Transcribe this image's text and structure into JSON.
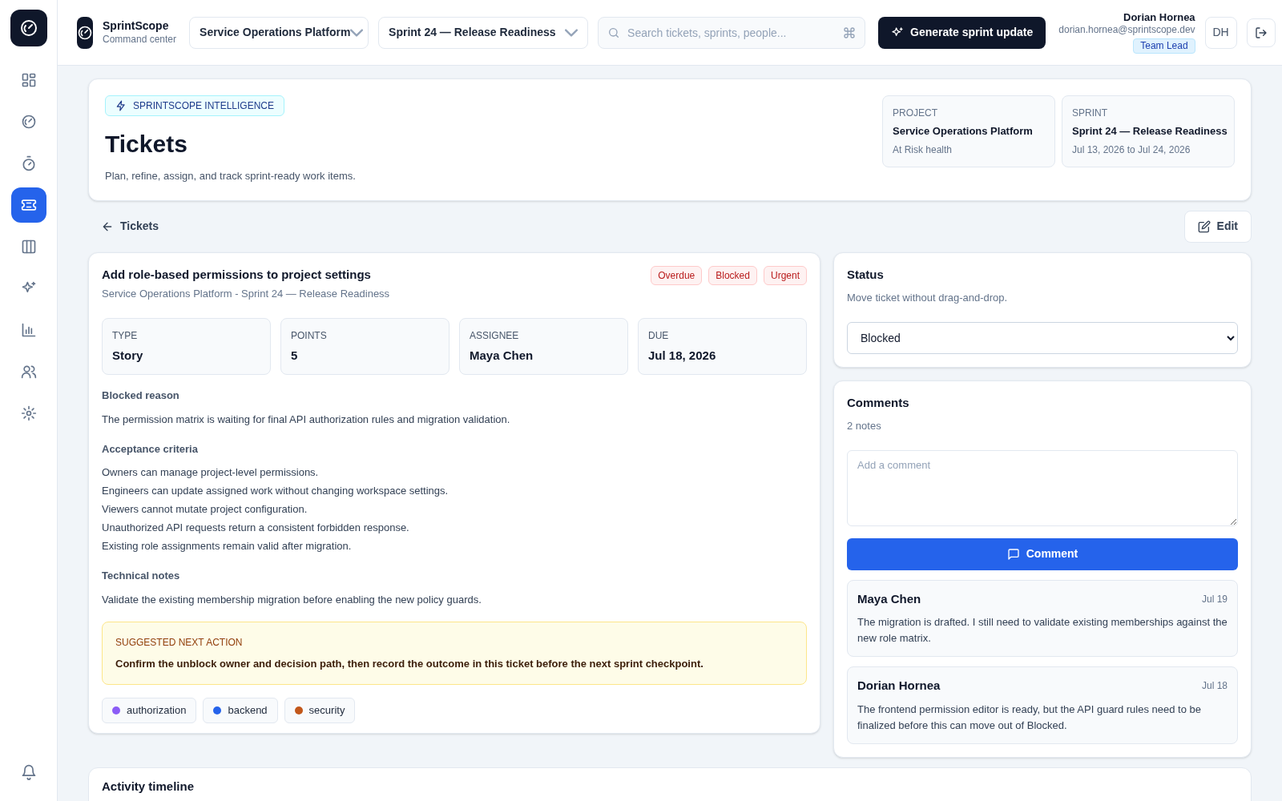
{
  "sidebar": {
    "items": [
      {
        "selected": false
      },
      {
        "selected": false
      },
      {
        "selected": false
      },
      {
        "selected": true
      },
      {
        "selected": false
      },
      {
        "selected": false
      },
      {
        "selected": false
      },
      {
        "selected": false
      },
      {
        "selected": false
      }
    ]
  },
  "topbar": {
    "brand": "SprintScope",
    "brand_sub": "Command center",
    "project_select": "Service Operations Platform",
    "sprint_select": "Sprint 24 — Release Readiness",
    "search": {
      "placeholder": "Search tickets, sprints, people..."
    },
    "generate_button": "Generate sprint update",
    "user": {
      "name": "Dorian Hornea",
      "email": "dorian.hornea@sprintscope.dev",
      "role": "Team Lead",
      "initials": "DH"
    }
  },
  "header": {
    "badge": "SPRINTSCOPE INTELLIGENCE",
    "title": "Tickets",
    "subtitle": "Plan, refine, assign, and track sprint-ready work items.",
    "cards": [
      {
        "label": "PROJECT",
        "value": "Service Operations Platform",
        "note": "At Risk health"
      },
      {
        "label": "SPRINT",
        "value": "Sprint 24 — Release Readiness",
        "note": "Jul 13, 2026 to Jul 24, 2026"
      }
    ]
  },
  "back_link": "Tickets",
  "edit_button": "Edit",
  "ticket": {
    "title": "Add role-based permissions to project settings",
    "context": "Service Operations Platform - Sprint 24 — Release Readiness",
    "badges": [
      "Overdue",
      "Blocked",
      "Urgent"
    ],
    "fields": [
      {
        "label": "TYPE",
        "value": "Story"
      },
      {
        "label": "POINTS",
        "value": "5"
      },
      {
        "label": "ASSIGNEE",
        "value": "Maya Chen"
      },
      {
        "label": "DUE",
        "value": "Jul 18, 2026"
      }
    ],
    "sections": [
      {
        "heading": "Blocked reason",
        "lines": [
          "The permission matrix is waiting for final API authorization rules and migration validation."
        ]
      },
      {
        "heading": "Acceptance criteria",
        "lines": [
          "Owners can manage project-level permissions.",
          "Engineers can update assigned work without changing workspace settings.",
          "Viewers cannot mutate project configuration.",
          "Unauthorized API requests return a consistent forbidden response.",
          "Existing role assignments remain valid after migration."
        ]
      },
      {
        "heading": "Technical notes",
        "lines": [
          "Validate the existing membership migration before enabling the new policy guards."
        ]
      }
    ],
    "suggestion": {
      "label": "SUGGESTED NEXT ACTION",
      "text": "Confirm the unblock owner and decision path, then record the outcome in this ticket before the next sprint checkpoint."
    },
    "tags": [
      {
        "label": "authorization",
        "color": "#8b5cf6"
      },
      {
        "label": "backend",
        "color": "#2563eb"
      },
      {
        "label": "security",
        "color": "#c2571a"
      }
    ]
  },
  "status": {
    "title": "Status",
    "subtitle": "Move ticket without drag-and-drop.",
    "value": "Blocked"
  },
  "comments": {
    "title": "Comments",
    "count": "2 notes",
    "input": {
      "placeholder": "Add a comment"
    },
    "button": "Comment",
    "items": [
      {
        "author": "Maya Chen",
        "date": "Jul 19",
        "text": "The migration is drafted. I still need to validate existing memberships against the new role matrix."
      },
      {
        "author": "Dorian Hornea",
        "date": "Jul 18",
        "text": "The frontend permission editor is ready, but the API guard rules need to be finalized before this can move out of Blocked."
      }
    ]
  },
  "activity": {
    "title": "Activity timeline"
  }
}
